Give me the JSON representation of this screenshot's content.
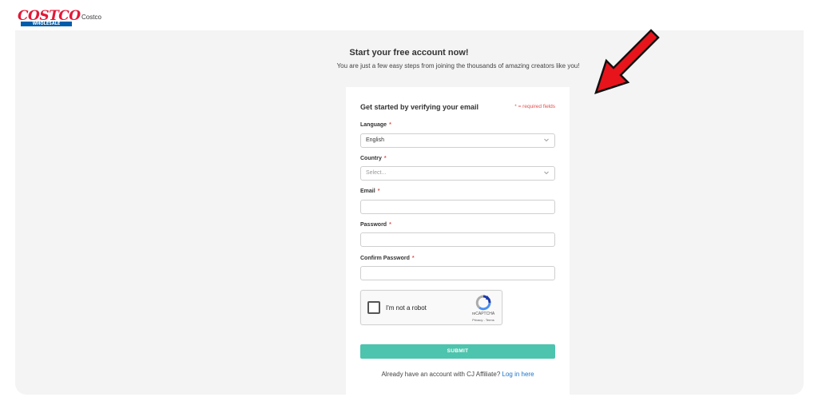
{
  "header": {
    "logo_text": "COSTCO",
    "logo_subtext": "WHOLESALE",
    "brand_name": "Costco"
  },
  "intro": {
    "title": "Start your free account now!",
    "subtitle": "You are just a few easy steps from joining the thousands of amazing creators like you!"
  },
  "form": {
    "title": "Get started by verifying your email",
    "required_note": "* = required fields",
    "required_marker": "*",
    "language": {
      "label": "Language",
      "value": "English"
    },
    "country": {
      "label": "Country",
      "placeholder": "Select..."
    },
    "email": {
      "label": "Email",
      "value": ""
    },
    "password": {
      "label": "Password",
      "value": ""
    },
    "confirm_password": {
      "label": "Confirm Password",
      "value": ""
    },
    "captcha": {
      "text": "I'm not a robot",
      "brand": "reCAPTCHA",
      "links": "Privacy - Terms"
    },
    "submit_label": "SUBMIT",
    "login_prompt": "Already have an account with CJ Affiliate?",
    "login_link": "Log in here"
  },
  "colors": {
    "accent_teal": "#4dc4ad",
    "required_red": "#e05050",
    "link_blue": "#1a73c9",
    "arrow_red": "#e8141c",
    "costco_red": "#e31837",
    "costco_blue": "#005daa"
  },
  "icons": {
    "dropdown": "chevron-down-icon",
    "captcha": "recaptcha-icon",
    "annotation": "red-arrow-icon"
  }
}
